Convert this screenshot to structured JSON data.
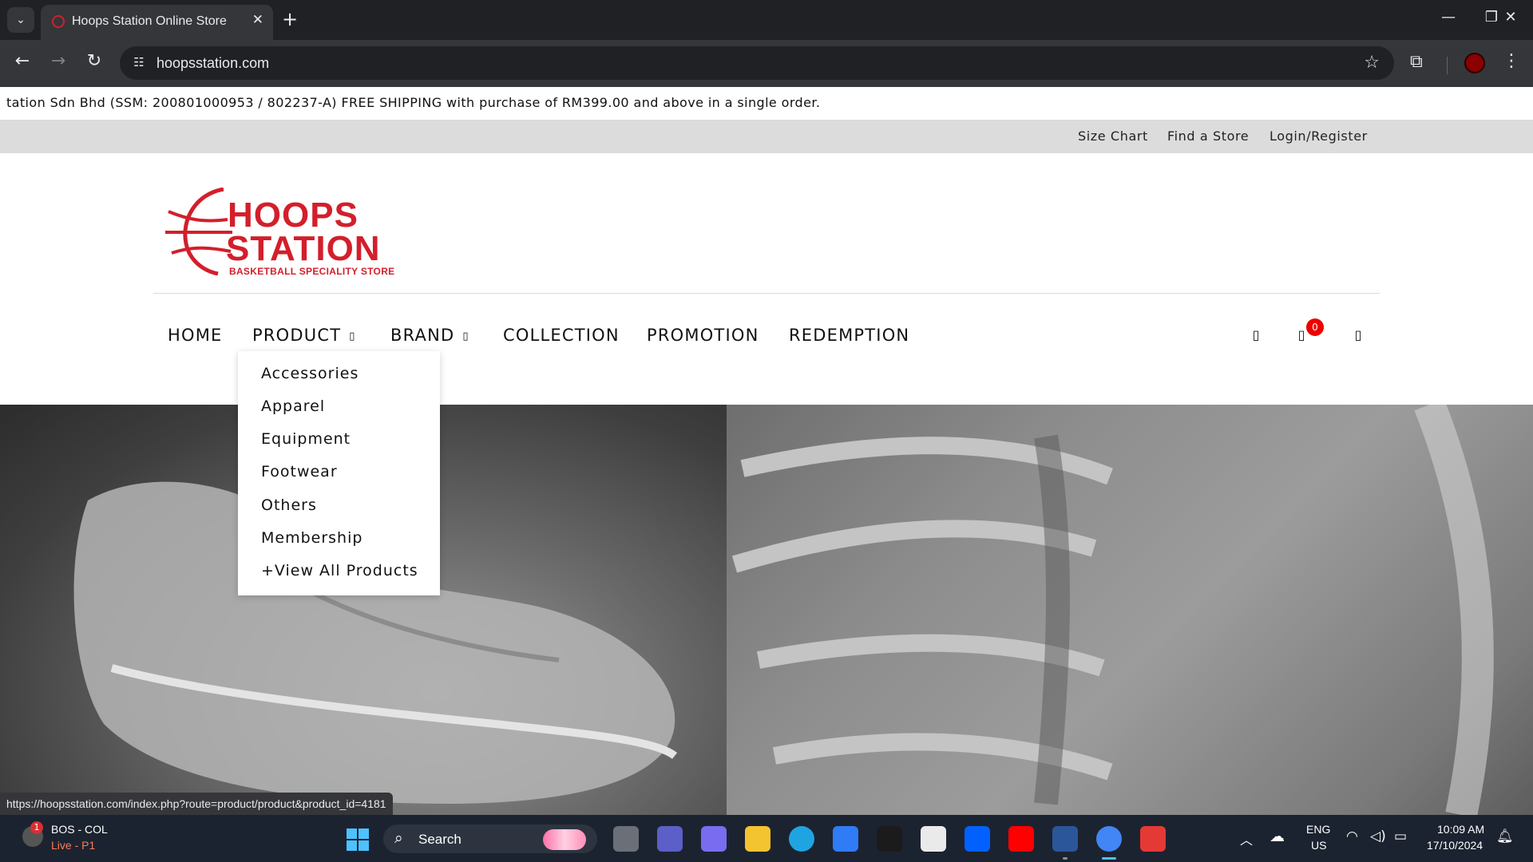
{
  "browser": {
    "tab_title": "Hoops Station Online Store",
    "tab_close": "✕",
    "new_tab": "+",
    "url": "hoopsstation.com",
    "status_url": "https://hoopsstation.com/index.php?route=product/product&product_id=4181",
    "icons": {
      "tab_list": "chevron-down-icon",
      "back": "back-arrow-icon",
      "forward": "forward-arrow-icon",
      "reload": "reload-icon",
      "site_info": "site-info-icon",
      "bookmark": "star-icon",
      "extensions": "puzzle-icon",
      "profile": "avatar-icon",
      "menu": "kebab-menu-icon",
      "minimize": "minimize-icon",
      "restore": "restore-icon",
      "close": "close-icon"
    }
  },
  "page": {
    "announcement": "tation Sdn Bhd (SSM: 200801000953 / 802237-A) FREE SHIPPING with purchase of RM399.00 and above in a single order.",
    "utility_links": [
      "Size Chart",
      "Find a Store",
      "Login/Register"
    ],
    "logo": {
      "line1": "HOOPS",
      "line2": "STATION",
      "tagline": "BASKETBALL SPECIALITY STORE",
      "brand_color": "#d31f2b"
    },
    "main_nav": [
      "HOME",
      "PRODUCT",
      "BRAND",
      "COLLECTION",
      "PROMOTION",
      "REDEMPTION"
    ],
    "nav_caret": "▯",
    "header_icons": {
      "search": "search-icon",
      "cart": "cart-icon",
      "account": "user-icon",
      "glyph": "▯"
    },
    "cart_count": "0",
    "product_dropdown": [
      "Accessories",
      "Apparel",
      "Equipment",
      "Footwear",
      "Others",
      "Membership",
      "+View All Products"
    ]
  },
  "taskbar": {
    "notification_count": "1",
    "weather_title": "BOS - COL",
    "weather_subtitle": "Live - P1",
    "search_label": "Search",
    "lang_1": "ENG",
    "lang_2": "US",
    "time": "10:09 AM",
    "date": "17/10/2024",
    "app_icons": [
      "task-view-icon",
      "teams-icon",
      "copilot-icon",
      "file-explorer-icon",
      "edge-icon",
      "store-icon",
      "amazon-icon",
      "amazon-app-icon",
      "dropbox-icon",
      "youtube-icon",
      "word-icon",
      "chrome-icon",
      "wps-icon"
    ],
    "app_colors": [
      "#6b6f78",
      "#5b5fc7",
      "#7a6cf0",
      "#f4c430",
      "#1fa4e2",
      "#2f7cf6",
      "#1b1b1b",
      "#eaeaea",
      "#0061fe",
      "#ff0000",
      "#2b579a",
      "#4285f4",
      "#e53935"
    ]
  }
}
